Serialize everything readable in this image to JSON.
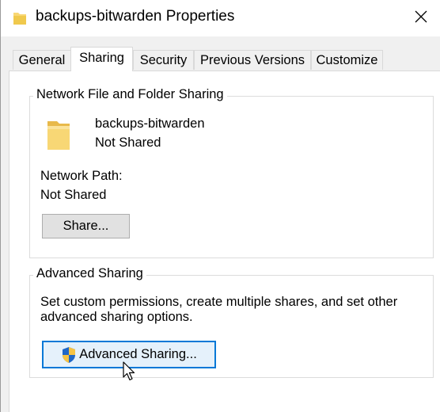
{
  "window": {
    "title": "backups-bitwarden Properties",
    "title_icon": "folder-icon",
    "close_icon": "close-icon"
  },
  "tabs": [
    {
      "label": "General",
      "active": false
    },
    {
      "label": "Sharing",
      "active": true
    },
    {
      "label": "Security",
      "active": false
    },
    {
      "label": "Previous Versions",
      "active": false
    },
    {
      "label": "Customize",
      "active": false
    }
  ],
  "network_sharing": {
    "legend": "Network File and Folder Sharing",
    "folder_icon": "folder-icon",
    "folder_name": "backups-bitwarden",
    "share_status": "Not Shared",
    "path_label": "Network Path:",
    "path_value": "Not Shared",
    "share_button_label": "Share..."
  },
  "advanced_sharing": {
    "legend": "Advanced Sharing",
    "description_line1": "Set custom permissions, create multiple shares, and set other",
    "description_line2": "advanced sharing options.",
    "button_icon": "uac-shield-icon",
    "button_label": "Advanced Sharing..."
  },
  "colors": {
    "folder": "#f8d775",
    "accent": "#0078d7",
    "shield_blue": "#1f67c7",
    "shield_yellow": "#f6c344"
  }
}
